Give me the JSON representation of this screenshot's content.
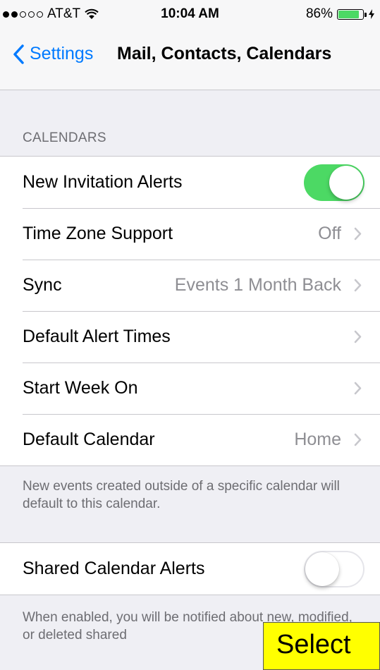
{
  "status_bar": {
    "carrier": "AT&T",
    "time": "10:04 AM",
    "battery": "86%",
    "battery_level": 0.86,
    "signal_bars_on": 2,
    "signal_bars_total": 5
  },
  "nav": {
    "back_label": "Settings",
    "title": "Mail, Contacts, Calendars"
  },
  "calendars": {
    "header": "CALENDARS",
    "rows": [
      {
        "label": "New Invitation Alerts",
        "toggle": "on"
      },
      {
        "label": "Time Zone Support",
        "value": "Off"
      },
      {
        "label": "Sync",
        "value": "Events 1 Month Back"
      },
      {
        "label": "Default Alert Times",
        "value": ""
      },
      {
        "label": "Start Week On",
        "value": ""
      },
      {
        "label": "Default Calendar",
        "value": "Home"
      }
    ],
    "footer": "New events created outside of a specific calendar will default to this calendar."
  },
  "shared": {
    "label": "Shared Calendar Alerts",
    "toggle": "off",
    "footer": "When enabled, you will be notified about new, modified, or deleted shared"
  },
  "overlay": {
    "label": "Select"
  },
  "colors": {
    "accent": "#007aff",
    "toggle_on": "#4cd964",
    "background": "#efeff4",
    "overlay": "#ffff00"
  }
}
